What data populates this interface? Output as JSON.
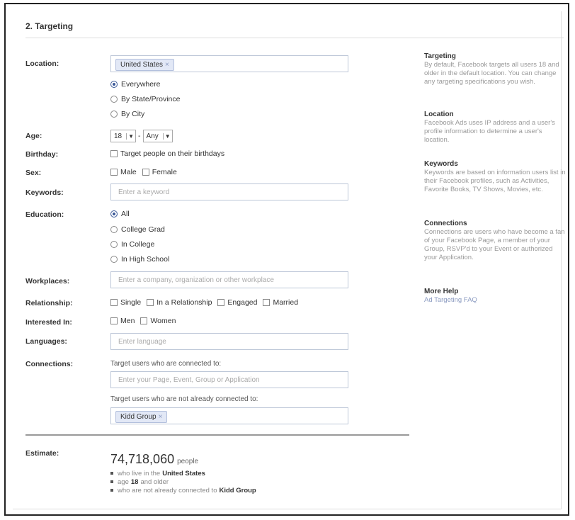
{
  "section": {
    "title": "2. Targeting"
  },
  "labels": {
    "location": "Location:",
    "age": "Age:",
    "birthday": "Birthday:",
    "sex": "Sex:",
    "keywords": "Keywords:",
    "education": "Education:",
    "workplaces": "Workplaces:",
    "relationship": "Relationship:",
    "interested_in": "Interested In:",
    "languages": "Languages:",
    "connections": "Connections:",
    "estimate": "Estimate:"
  },
  "location": {
    "token": "United States",
    "token_remove": "×",
    "options": [
      "Everywhere",
      "By State/Province",
      "By City"
    ],
    "selected": "Everywhere"
  },
  "age": {
    "min": "18",
    "separator": "-",
    "max": "Any",
    "arrow": "▼"
  },
  "birthday": {
    "option": "Target people on their birthdays"
  },
  "sex": {
    "options": [
      "Male",
      "Female"
    ]
  },
  "keywords": {
    "placeholder": "Enter a keyword"
  },
  "education": {
    "options": [
      "All",
      "College Grad",
      "In College",
      "In High School"
    ],
    "selected": "All"
  },
  "workplaces": {
    "placeholder": "Enter a company, organization or other workplace"
  },
  "relationship": {
    "options": [
      "Single",
      "In a Relationship",
      "Engaged",
      "Married"
    ]
  },
  "interested_in": {
    "options": [
      "Men",
      "Women"
    ]
  },
  "languages": {
    "placeholder": "Enter language"
  },
  "connections": {
    "connected_label": "Target users who are connected to:",
    "connected_placeholder": "Enter your Page, Event, Group or Application",
    "not_connected_label": "Target users who are not already connected to:",
    "not_connected_token": "Kidd Group",
    "token_remove": "×"
  },
  "estimate": {
    "count": "74,718,060",
    "unit": "people",
    "line1_pre": "who live in the",
    "line1_bold": "United States",
    "line2_pre": "age",
    "line2_bold": "18",
    "line2_post": "and older",
    "line3_pre": "who are not already connected to",
    "line3_bold": "Kidd Group"
  },
  "sidebar": {
    "targeting_title": "Targeting",
    "targeting_text": "By default, Facebook targets all users 18 and older in the default location. You can change any targeting specifications you wish.",
    "location_title": "Location",
    "location_text": "Facebook Ads uses IP address and a user's profile information to determine a user's location.",
    "keywords_title": "Keywords",
    "keywords_text": "Keywords are based on information users list in their Facebook profiles, such as Activities, Favorite Books, TV Shows, Movies, etc.",
    "connections_title": "Connections",
    "connections_text": "Connections are users who have become a fan of your Facebook Page, a member of your Group, RSVP'd to your Event or authorized your Application.",
    "help_title": "More Help",
    "help_link": "Ad Targeting FAQ"
  },
  "colors": {
    "accent": "#3b5998",
    "token_bg": "#e2e8f6",
    "border": "#bdc7d8"
  }
}
